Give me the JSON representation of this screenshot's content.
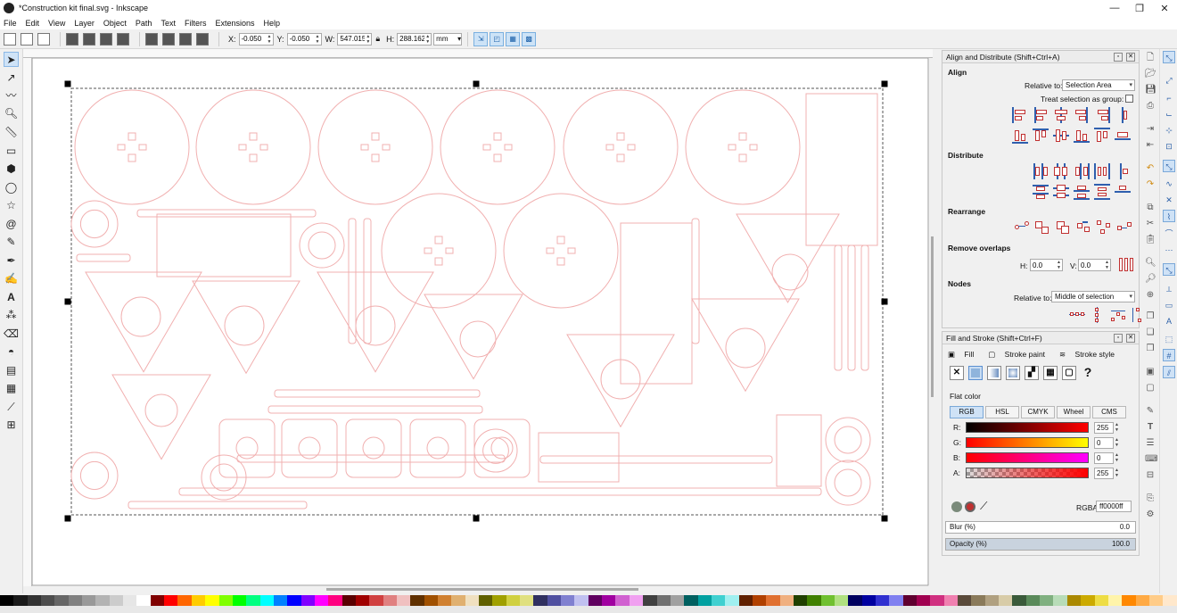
{
  "window": {
    "title": "*Construction kit final.svg - Inkscape",
    "minimize": "—",
    "maximize": "❐",
    "close": "✕"
  },
  "menu": [
    "File",
    "Edit",
    "View",
    "Layer",
    "Object",
    "Path",
    "Text",
    "Filters",
    "Extensions",
    "Help"
  ],
  "controls": {
    "x_label": "X:",
    "x_value": "-0.050",
    "y_label": "Y:",
    "y_value": "-0.050",
    "w_label": "W:",
    "w_value": "547.015",
    "h_label": "H:",
    "h_value": "288.162",
    "unit": "mm"
  },
  "align_panel": {
    "title": "Align and Distribute (Shift+Ctrl+A)",
    "align_heading": "Align",
    "relative_to_label": "Relative to:",
    "relative_to_value": "Selection Area",
    "treat_group_label": "Treat selection as group:",
    "distribute_heading": "Distribute",
    "rearrange_heading": "Rearrange",
    "remove_overlaps_heading": "Remove overlaps",
    "h_label": "H:",
    "h_value": "0.0",
    "v_label": "V:",
    "v_value": "0.0",
    "nodes_heading": "Nodes",
    "nodes_relative_label": "Relative to:",
    "nodes_relative_value": "Middle of selection"
  },
  "fill_panel": {
    "title": "Fill and Stroke (Shift+Ctrl+F)",
    "tab_fill": "Fill",
    "tab_stroke_paint": "Stroke paint",
    "tab_stroke_style": "Stroke style",
    "unset_glyph": "?",
    "flat_color_label": "Flat color",
    "modes": [
      "RGB",
      "HSL",
      "CMYK",
      "Wheel",
      "CMS"
    ],
    "r_label": "R:",
    "r_value": "255",
    "g_label": "G:",
    "g_value": "0",
    "b_label": "B:",
    "b_value": "0",
    "a_label": "A:",
    "a_value": "255",
    "rgba_label": "RGBA:",
    "rgba_value": "ff0000ff",
    "blur_label": "Blur (%)",
    "blur_value": "0.0",
    "opacity_label": "Opacity (%)",
    "opacity_value": "100.0",
    "opacity": 1.0
  },
  "colors": {
    "stroke": "#f1b0b0",
    "accent": "#2f5fae",
    "selection": "#6aa0dc"
  }
}
